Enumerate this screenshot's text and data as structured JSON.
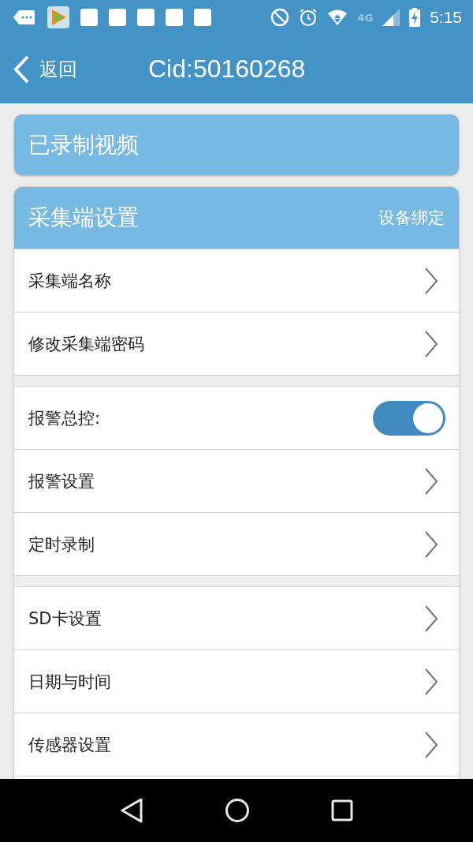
{
  "status_bar": {
    "network": "4G",
    "time": "5:15"
  },
  "header": {
    "back_label": "返回",
    "title": "Cid:50160268"
  },
  "recorded_card": {
    "title": "已录制视频"
  },
  "settings_card": {
    "title": "采集端设置",
    "action": "设备绑定",
    "groups": [
      [
        {
          "kind": "link",
          "label": "采集端名称"
        },
        {
          "kind": "link",
          "label": "修改采集端密码"
        }
      ],
      [
        {
          "kind": "toggle",
          "label": "报警总控:",
          "on": true
        },
        {
          "kind": "link",
          "label": "报警设置"
        },
        {
          "kind": "link",
          "label": "定时录制"
        }
      ],
      [
        {
          "kind": "link",
          "label": "SD卡设置"
        },
        {
          "kind": "link",
          "label": "日期与时间"
        },
        {
          "kind": "link",
          "label": "传感器设置"
        }
      ]
    ]
  }
}
